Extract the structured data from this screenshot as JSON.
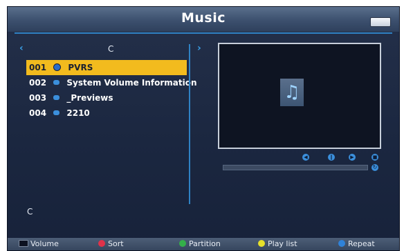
{
  "header": {
    "title": "Music"
  },
  "browser": {
    "drive": "C",
    "items": [
      {
        "num": "001",
        "name": "PVRS",
        "selected": true
      },
      {
        "num": "002",
        "name": "System Volume Information",
        "selected": false
      },
      {
        "num": "003",
        "name": "_Previews",
        "selected": false
      },
      {
        "num": "004",
        "name": "2210",
        "selected": false
      }
    ],
    "current_path": "C"
  },
  "footer": {
    "volume": "Volume",
    "sort": "Sort",
    "partition": "Partition",
    "playlist": "Play list",
    "repeat": "Repeat"
  },
  "colors": {
    "accent": "#2f82c4",
    "selected_row": "#f2bb1e",
    "red": "#e0324a",
    "green": "#34b04a",
    "yellow": "#e6e02a",
    "blue": "#2f82d8"
  },
  "icons": {
    "battery": "battery-icon",
    "music": "music-note-icon"
  }
}
